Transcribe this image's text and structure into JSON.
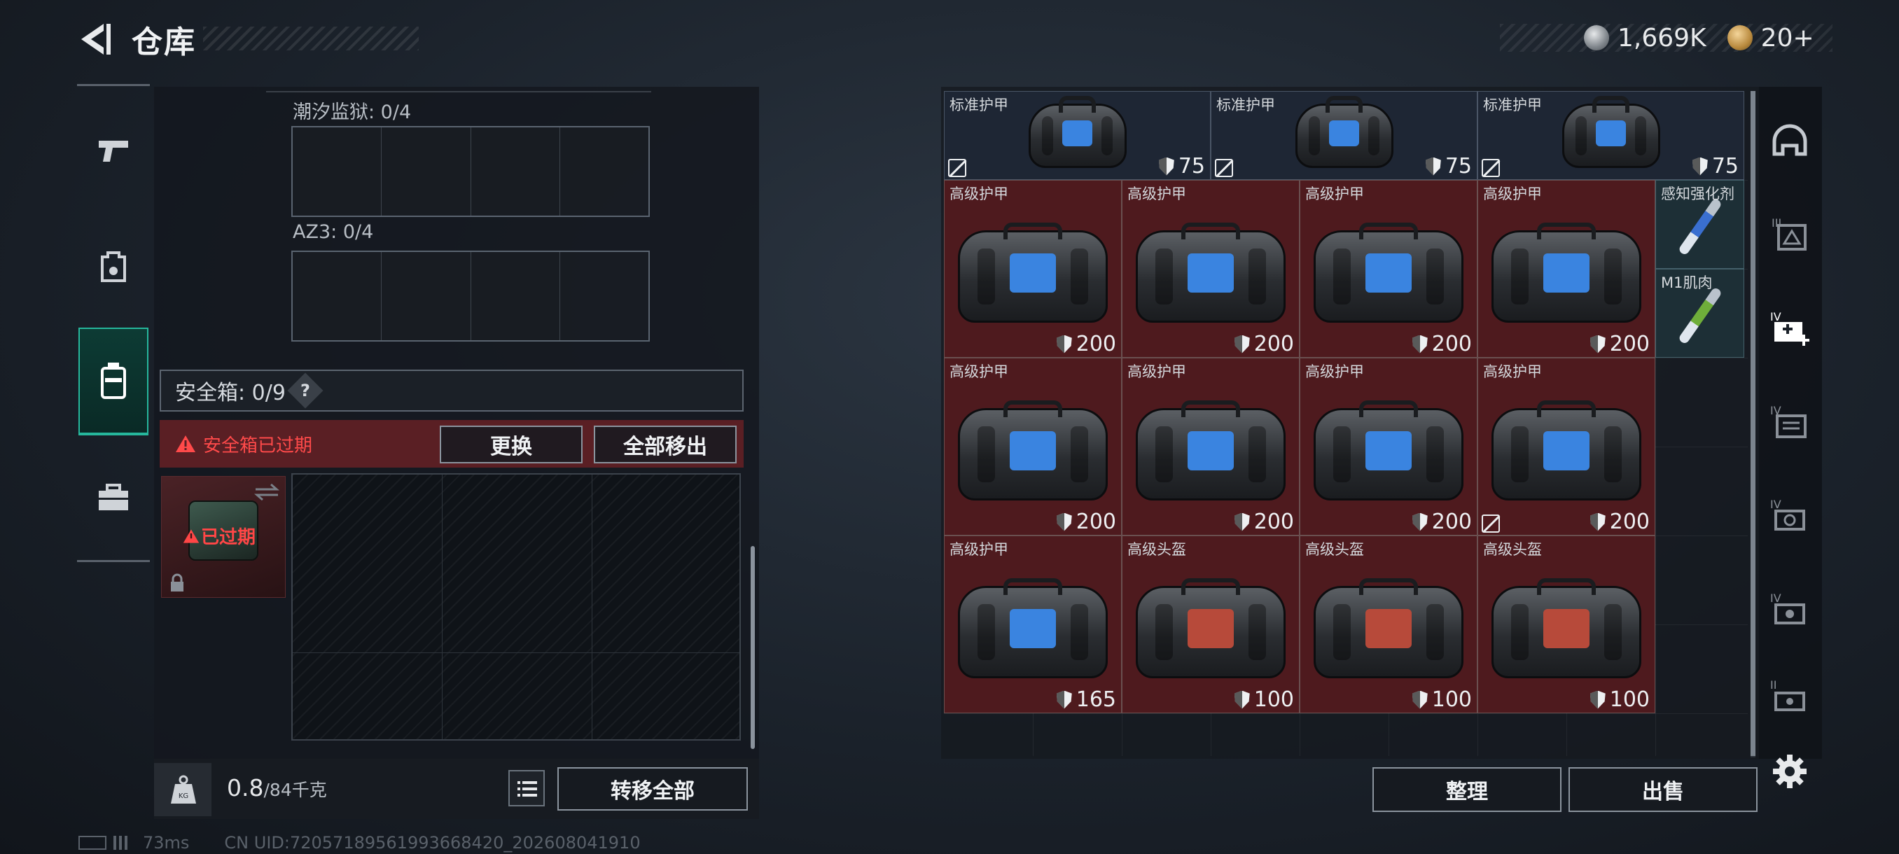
{
  "header": {
    "title": "仓库"
  },
  "currency": {
    "silver": "1,669K",
    "gold": "20+"
  },
  "left": {
    "slot1_label": "潮汐监狱: 0/4",
    "slot2_label": "AZ3: 0/4",
    "safe_title": "安全箱: 0/9",
    "help": "?",
    "warning": "安全箱已过期",
    "replace_btn": "更换",
    "remove_all_btn": "全部移出",
    "case_expired": "已过期",
    "weight_value": "0.8",
    "weight_cap": "/84千克",
    "transfer_all_btn": "转移全部"
  },
  "right": {
    "sort_btn": "整理",
    "sell_btn": "出售",
    "items": [
      {
        "name": "标准护甲",
        "value": "75",
        "kind": "armor-std",
        "noins": true
      },
      {
        "name": "标准护甲",
        "value": "75",
        "kind": "armor-std",
        "noins": true
      },
      {
        "name": "标准护甲",
        "value": "75",
        "kind": "armor-std",
        "noins": true
      },
      {
        "name": "高级护甲",
        "value": "200",
        "kind": "armor"
      },
      {
        "name": "高级护甲",
        "value": "200",
        "kind": "armor"
      },
      {
        "name": "高级护甲",
        "value": "200",
        "kind": "armor"
      },
      {
        "name": "高级护甲",
        "value": "200",
        "kind": "armor"
      },
      {
        "name": "感知强化剂",
        "value": "",
        "kind": "syringe-blue"
      },
      {
        "name": "M1肌肉",
        "value": "",
        "kind": "syringe-green"
      },
      {
        "name": "高级护甲",
        "value": "200",
        "kind": "armor"
      },
      {
        "name": "高级护甲",
        "value": "200",
        "kind": "armor"
      },
      {
        "name": "高级护甲",
        "value": "200",
        "kind": "armor"
      },
      {
        "name": "高级护甲",
        "value": "200",
        "kind": "armor",
        "noins": true
      },
      {
        "name": "高级护甲",
        "value": "165",
        "kind": "armor"
      },
      {
        "name": "高级头盔",
        "value": "100",
        "kind": "helmet"
      },
      {
        "name": "高级头盔",
        "value": "100",
        "kind": "helmet"
      },
      {
        "name": "高级头盔",
        "value": "100",
        "kind": "helmet"
      }
    ]
  },
  "status": {
    "ping": "73ms",
    "uid": "CN UID:72057189561993668420_202608041910"
  },
  "colors": {
    "accent": "#26b79c",
    "warning": "#ff4a4a",
    "item_red": "#4e1a1e",
    "item_dark": "#1e2634"
  }
}
